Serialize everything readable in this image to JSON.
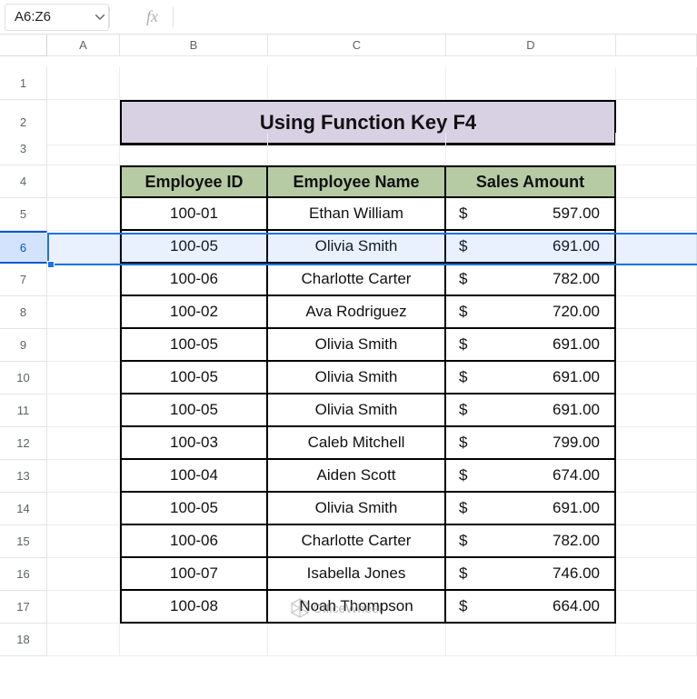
{
  "name_box": "A6:Z6",
  "fx_label": "fx",
  "formula_value": "",
  "col_headers": [
    "A",
    "B",
    "C",
    "D"
  ],
  "row_headers": [
    "1",
    "2",
    "3",
    "4",
    "5",
    "6",
    "7",
    "8",
    "9",
    "10",
    "11",
    "12",
    "13",
    "14",
    "15",
    "16",
    "17",
    "18"
  ],
  "selected_row_index": 5,
  "title": "Using Function Key F4",
  "table_headers": {
    "b": "Employee ID",
    "c": "Employee Name",
    "d": "Sales Amount"
  },
  "currency": "$",
  "rows": [
    {
      "id": "100-01",
      "name": "Ethan William",
      "amount": "597.00"
    },
    {
      "id": "100-05",
      "name": "Olivia Smith",
      "amount": "691.00"
    },
    {
      "id": "100-06",
      "name": "Charlotte Carter",
      "amount": "782.00"
    },
    {
      "id": "100-02",
      "name": "Ava Rodriguez",
      "amount": "720.00"
    },
    {
      "id": "100-05",
      "name": "Olivia Smith",
      "amount": "691.00"
    },
    {
      "id": "100-05",
      "name": "Olivia Smith",
      "amount": "691.00"
    },
    {
      "id": "100-05",
      "name": "Olivia Smith",
      "amount": "691.00"
    },
    {
      "id": "100-03",
      "name": "Caleb Mitchell",
      "amount": "799.00"
    },
    {
      "id": "100-04",
      "name": "Aiden Scott",
      "amount": "674.00"
    },
    {
      "id": "100-05",
      "name": "Olivia Smith",
      "amount": "691.00"
    },
    {
      "id": "100-06",
      "name": "Charlotte Carter",
      "amount": "782.00"
    },
    {
      "id": "100-07",
      "name": "Isabella Jones",
      "amount": "746.00"
    },
    {
      "id": "100-08",
      "name": "Noah Thompson",
      "amount": "664.00"
    }
  ],
  "watermark": "OfficeWheel"
}
